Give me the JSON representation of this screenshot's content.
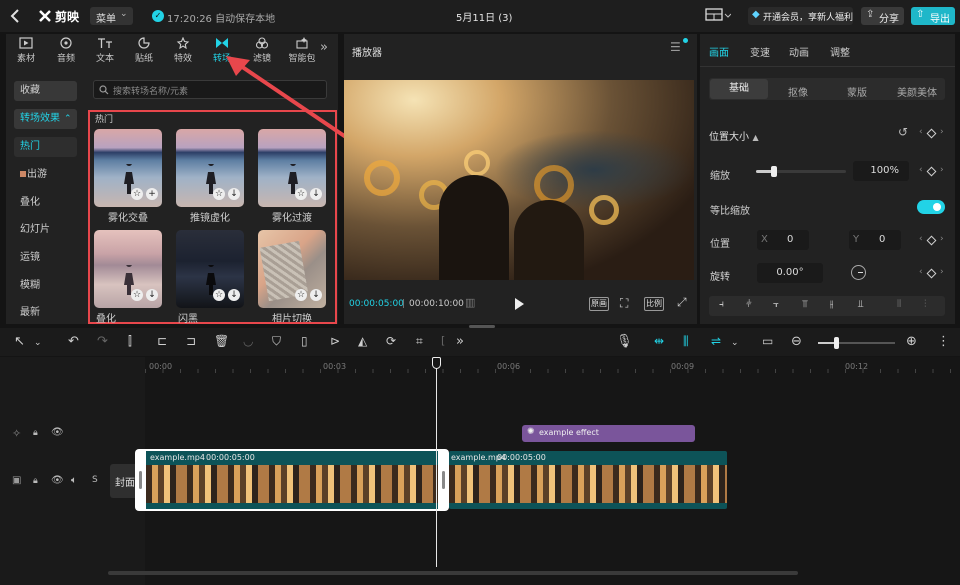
{
  "topbar": {
    "logo_text": "剪映",
    "menu_label": "菜单",
    "autosave_text": "17:20:26 自动保存本地",
    "project_title": "5月11日 (3)",
    "vip_text": "开通会员，享新人福利",
    "share_label": "分享",
    "export_label": "导出"
  },
  "media_tabs": [
    {
      "label": "素材",
      "icon": "media-icon"
    },
    {
      "label": "音频",
      "icon": "audio-icon"
    },
    {
      "label": "文本",
      "icon": "text-icon"
    },
    {
      "label": "贴纸",
      "icon": "sticker-icon"
    },
    {
      "label": "特效",
      "icon": "effects-icon"
    },
    {
      "label": "转场",
      "icon": "transition-icon"
    },
    {
      "label": "滤镜",
      "icon": "filter-icon"
    },
    {
      "label": "智能包",
      "icon": "smart-package-icon"
    }
  ],
  "sidebar": {
    "items": [
      "收藏",
      "转场效果",
      "热门",
      "出游",
      "叠化",
      "幻灯片",
      "运镜",
      "模糊",
      "最新"
    ]
  },
  "search": {
    "placeholder": "搜索转场名称/元素"
  },
  "section_title": "热门",
  "transitions": [
    {
      "label": "雾化交叠",
      "action": "+"
    },
    {
      "label": "推镜虚化",
      "action": "↓"
    },
    {
      "label": "雾化过渡",
      "action": "↓"
    },
    {
      "label": "叠化",
      "action": "↓"
    },
    {
      "label": "闪黑",
      "action": "↓"
    },
    {
      "label": "相片切换",
      "action": "↓"
    }
  ],
  "player": {
    "title": "播放器",
    "current_time": "00:00:05:00",
    "total_time": "00:00:10:00",
    "original_label": "原画",
    "ratio_label": "比例"
  },
  "inspector": {
    "tabs": [
      "画面",
      "变速",
      "动画",
      "调整"
    ],
    "subtabs": [
      "基础",
      "抠像",
      "蒙版",
      "美颜美体"
    ],
    "position_size": "位置大小",
    "scale_label": "缩放",
    "scale_value": "100%",
    "scale_level": 0.2,
    "uniform_label": "等比缩放",
    "uniform_on": true,
    "position_label": "位置",
    "x_label": "X",
    "x_value": "0",
    "y_label": "Y",
    "y_value": "0",
    "rotate_label": "旋转",
    "rotate_value": "0.00°"
  },
  "timeline": {
    "ruler_labels": [
      "00:00",
      "00:03",
      "00:06",
      "00:09",
      "00:12"
    ],
    "effect_clip_label": "example effect",
    "cover_label": "封面",
    "clip1_label": "example.mp4",
    "clip1_duration": "00:00:05:00",
    "clip2_label": "example.mp4",
    "clip2_duration": "00:00:05:00"
  },
  "colors": {
    "accent": "#22d3e6",
    "annotation_red": "#e8474c",
    "effect_purple": "#7a559b",
    "clip_teal": "#0d5358"
  }
}
